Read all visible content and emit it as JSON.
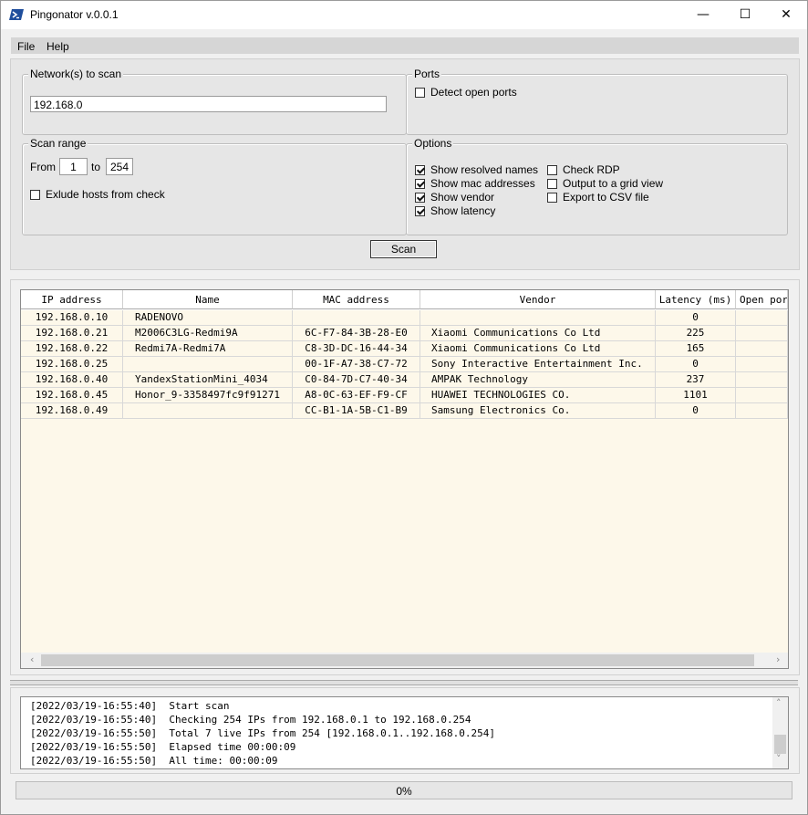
{
  "window": {
    "title": "Pingonator v.0.0.1"
  },
  "menu": {
    "file": "File",
    "help": "Help"
  },
  "networks": {
    "label": "Network(s) to scan",
    "value": "192.168.0"
  },
  "ports": {
    "label": "Ports",
    "detect_open_ports": {
      "label": "Detect open ports",
      "checked": false
    }
  },
  "range": {
    "label": "Scan range",
    "from_label": "From",
    "from_value": "1",
    "to_label": "to",
    "to_value": "254",
    "exclude": {
      "label": "Exlude hosts from check",
      "checked": false
    }
  },
  "options": {
    "label": "Options",
    "show_resolved_names": {
      "label": "Show resolved names",
      "checked": true
    },
    "show_mac": {
      "label": "Show mac addresses",
      "checked": true
    },
    "show_vendor": {
      "label": "Show vendor",
      "checked": true
    },
    "show_latency": {
      "label": "Show latency",
      "checked": true
    },
    "check_rdp": {
      "label": "Check RDP",
      "checked": false
    },
    "grid_view": {
      "label": "Output to a grid view",
      "checked": false
    },
    "export_csv": {
      "label": "Export to CSV file",
      "checked": false
    }
  },
  "scan_button": "Scan",
  "results": {
    "columns": [
      "IP address",
      "Name",
      "MAC address",
      "Vendor",
      "Latency (ms)",
      "Open ports"
    ],
    "rows": [
      {
        "ip": "192.168.0.10",
        "name": "RADENOVO",
        "mac": "",
        "vendor": "",
        "latency": "0",
        "open": ""
      },
      {
        "ip": "192.168.0.21",
        "name": "M2006C3LG-Redmi9A",
        "mac": "6C-F7-84-3B-28-E0",
        "vendor": "Xiaomi Communications Co Ltd",
        "latency": "225",
        "open": ""
      },
      {
        "ip": "192.168.0.22",
        "name": "Redmi7A-Redmi7A",
        "mac": "C8-3D-DC-16-44-34",
        "vendor": "Xiaomi Communications Co Ltd",
        "latency": "165",
        "open": ""
      },
      {
        "ip": "192.168.0.25",
        "name": "",
        "mac": "00-1F-A7-38-C7-72",
        "vendor": "Sony Interactive Entertainment Inc.",
        "latency": "0",
        "open": ""
      },
      {
        "ip": "192.168.0.40",
        "name": "YandexStationMini_4034",
        "mac": "C0-84-7D-C7-40-34",
        "vendor": "AMPAK Technology",
        "latency": "237",
        "open": ""
      },
      {
        "ip": "192.168.0.45",
        "name": "Honor_9-3358497fc9f91271",
        "mac": "A8-0C-63-EF-F9-CF",
        "vendor": "HUAWEI TECHNOLOGIES CO.",
        "latency": "1101",
        "open": ""
      },
      {
        "ip": "192.168.0.49",
        "name": "",
        "mac": "CC-B1-1A-5B-C1-B9",
        "vendor": "Samsung Electronics Co.",
        "latency": "0",
        "open": ""
      }
    ]
  },
  "log": [
    "[2022/03/19-16:55:40]  Start scan",
    "[2022/03/19-16:55:40]  Checking 254 IPs from 192.168.0.1 to 192.168.0.254",
    "[2022/03/19-16:55:50]  Total 7 live IPs from 254 [192.168.0.1..192.168.0.254]",
    "[2022/03/19-16:55:50]  Elapsed time 00:00:09",
    "[2022/03/19-16:55:50]  All time: 00:00:09"
  ],
  "progress": "0%"
}
